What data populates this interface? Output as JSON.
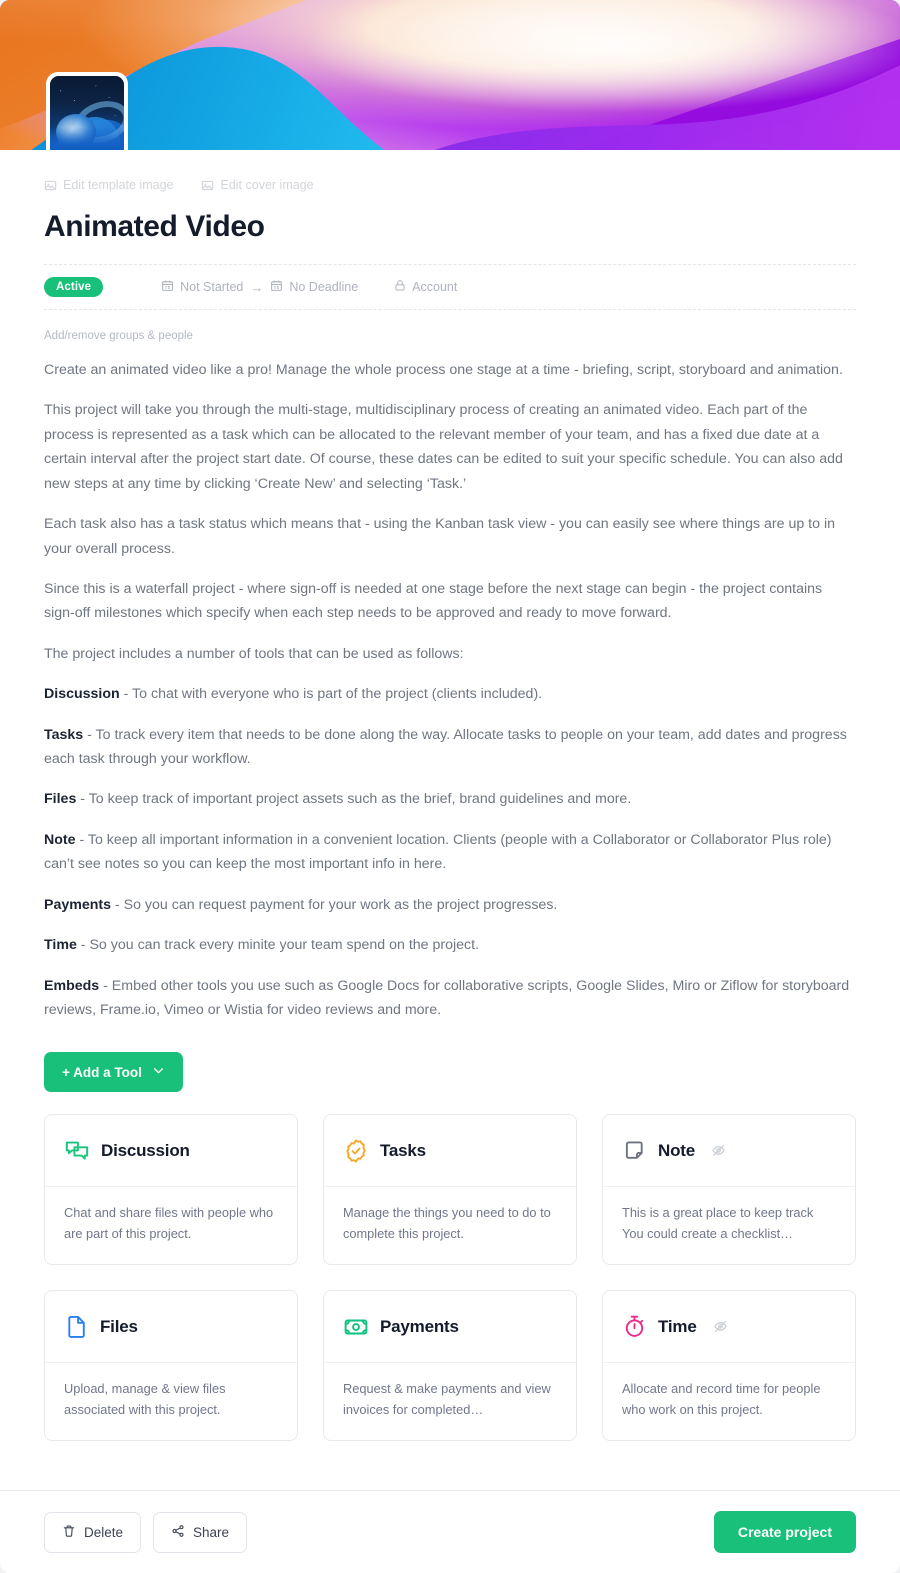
{
  "cover": {
    "edit_template_image_label": "Edit template image",
    "edit_cover_image_label": "Edit cover image"
  },
  "header": {
    "title": "Animated Video",
    "status_badge": "Active",
    "start_date": "Not Started",
    "arrow": "→",
    "deadline": "No Deadline",
    "visibility": "Account",
    "groups_people_link": "Add/remove groups & people"
  },
  "colors": {
    "accent_green": "#18c07a",
    "title": "#141b2b",
    "body_text": "#6f7682",
    "muted": "#aeb3bd",
    "discussion_icon": "#19c37d",
    "tasks_icon": "#f5a623",
    "note_icon": "#6b7280",
    "files_icon": "#2b7fef",
    "payments_icon": "#0ec27f",
    "time_icon": "#ec2a8a"
  },
  "description": {
    "paragraphs": [
      {
        "lead": "",
        "text": "Create an animated video like a pro! Manage the whole process one stage at a time - briefing, script, storyboard and animation."
      },
      {
        "lead": "",
        "text": "This project will take you through the multi-stage, multidisciplinary process of creating an animated video. Each part of the process is represented as a task which can be allocated to the relevant member of your team, and has a fixed due date at a certain interval after the project start date. Of course, these dates can be edited to suit your specific schedule. You can also add new steps at any time by clicking ‘Create New’ and selecting ‘Task.’"
      },
      {
        "lead": "",
        "text": "Each task also has a task status which means that - using the Kanban task view - you can easily see where things are up to in your overall process."
      },
      {
        "lead": "",
        "text": "Since this is a waterfall project - where sign-off is needed at one stage before the next stage can begin - the project contains sign-off milestones which specify when each step needs to be approved and ready to move forward."
      },
      {
        "lead": "",
        "text": "The project includes a number of tools that can be used as follows:"
      },
      {
        "lead": "Discussion",
        "text": " - To chat with everyone who is part of the project (clients included)."
      },
      {
        "lead": "Tasks",
        "text": " - To track every item that needs to be done along the way. Allocate tasks to people on your team, add dates and progress each task through your workflow."
      },
      {
        "lead": "Files",
        "text": " - To keep track of important project assets such as the brief, brand guidelines and more."
      },
      {
        "lead": "Note",
        "text": " - To keep all important information in a convenient location. Clients (people with a Collaborator or Collaborator Plus role) can’t see notes so you can keep the most important info in here."
      },
      {
        "lead": "Payments",
        "text": " - So you can request payment for your work as the project progresses."
      },
      {
        "lead": "Time",
        "text": " - So you can track every minite your team spend on the project."
      },
      {
        "lead": "Embeds",
        "text": " - Embed other tools you use such as Google Docs for collaborative scripts, Google Slides, Miro or Ziflow for storyboard reviews, Frame.io, Vimeo or Wistia for video reviews and more."
      }
    ]
  },
  "add_tool": {
    "label": "+ Add a Tool"
  },
  "tools": [
    {
      "name": "Discussion",
      "icon": "chat-bubbles-icon",
      "hidden_indicator": false,
      "description": "Chat and share files with people who are part of this project."
    },
    {
      "name": "Tasks",
      "icon": "check-badge-icon",
      "hidden_indicator": false,
      "description": "Manage the things you need to do to complete this project."
    },
    {
      "name": "Note",
      "icon": "sticky-note-icon",
      "hidden_indicator": true,
      "description": "This is a great place to keep track You could create a checklist…"
    },
    {
      "name": "Files",
      "icon": "document-icon",
      "hidden_indicator": false,
      "description": "Upload, manage & view files associated with this project."
    },
    {
      "name": "Payments",
      "icon": "banknote-icon",
      "hidden_indicator": false,
      "description": "Request & make payments and view invoices for completed…"
    },
    {
      "name": "Time",
      "icon": "stopwatch-icon",
      "hidden_indicator": true,
      "description": "Allocate and record time for people who work on this project."
    }
  ],
  "footer": {
    "delete_label": "Delete",
    "share_label": "Share",
    "create_label": "Create project"
  }
}
